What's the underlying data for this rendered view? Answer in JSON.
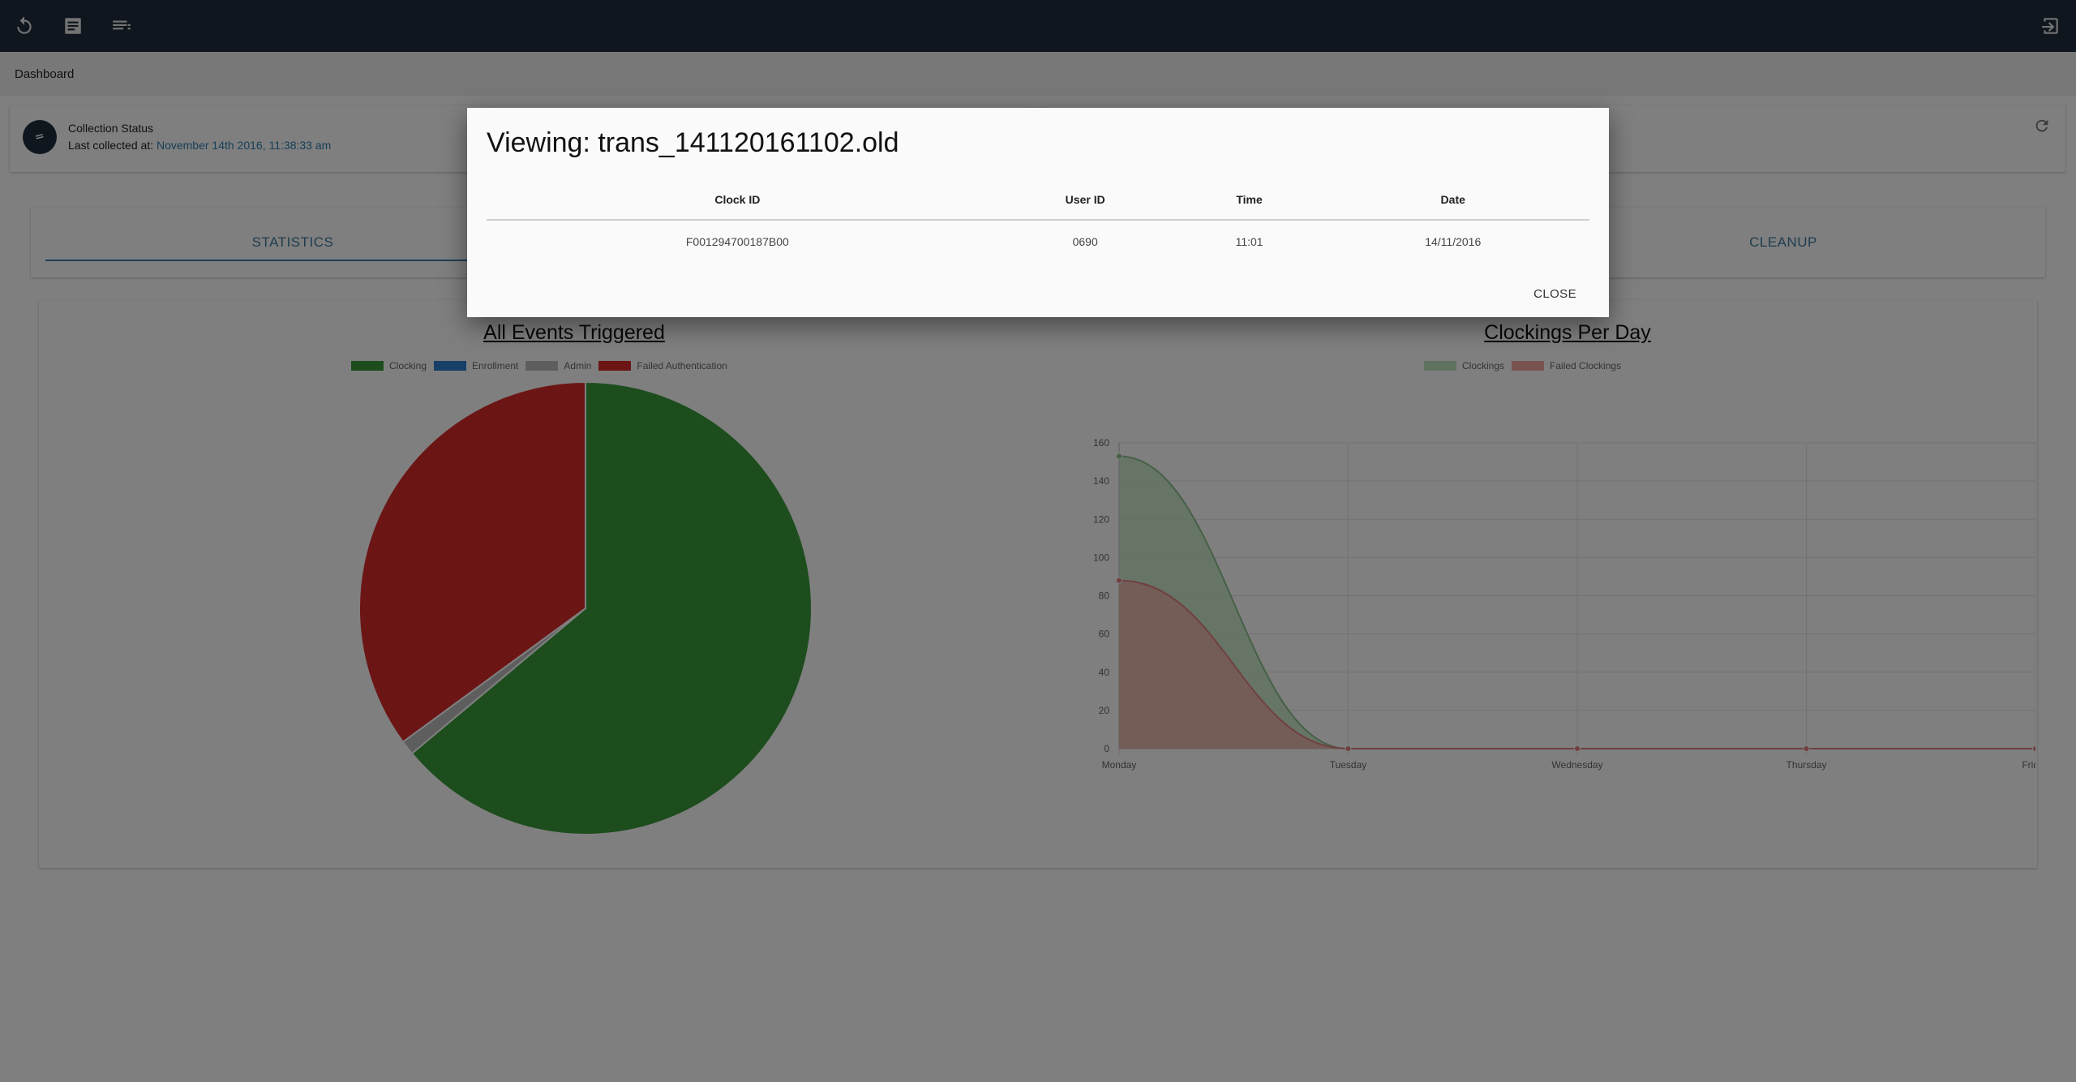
{
  "app": {
    "breadcrumb": "Dashboard"
  },
  "topbar": {
    "icons": [
      "refresh-icon",
      "document-icon",
      "list-icon",
      "logout-icon"
    ]
  },
  "status": {
    "title": "Collection Status",
    "last_collected_label": "Last collected at:",
    "last_collected_value": "November 14th 2016, 11:38:33 am"
  },
  "tabs": [
    {
      "label": "STATISTICS",
      "active": true
    },
    {
      "label": "CLEANUP",
      "active": false
    }
  ],
  "colors": {
    "topbar": "#1f2d3a",
    "clocking": "#3a9a3a",
    "enrollment": "#2f7fd0",
    "admin": "#bdbdbd",
    "failed": "#d92a2a",
    "clockings_area": "#bfe3bf",
    "failed_area": "#f2a7a3"
  },
  "chart_data": [
    {
      "type": "pie",
      "title": "All Events Triggered",
      "labels": [
        "Clocking",
        "Enrollment",
        "Admin",
        "Failed Authentication"
      ],
      "values": [
        62,
        0,
        1,
        34
      ]
    },
    {
      "type": "area",
      "title": "Clockings Per Day",
      "categories": [
        "Monday",
        "Tuesday",
        "Wednesday",
        "Thursday",
        "Friday"
      ],
      "series": [
        {
          "name": "Clockings",
          "values": [
            153,
            0,
            0,
            0,
            0
          ]
        },
        {
          "name": "Failed Clockings",
          "values": [
            88,
            0,
            0,
            0,
            0
          ]
        }
      ],
      "ylim": [
        0,
        160
      ],
      "yticks": [
        0,
        20,
        40,
        60,
        80,
        100,
        120,
        140,
        160
      ],
      "grid": true,
      "legend": "top"
    }
  ],
  "modal": {
    "title": "Viewing: trans_141120161102.old",
    "columns": [
      "Clock ID",
      "User ID",
      "Time",
      "Date"
    ],
    "rows": [
      [
        "F001294700187B00",
        "0690",
        "11:01",
        "14/11/2016"
      ]
    ],
    "close_label": "CLOSE"
  }
}
